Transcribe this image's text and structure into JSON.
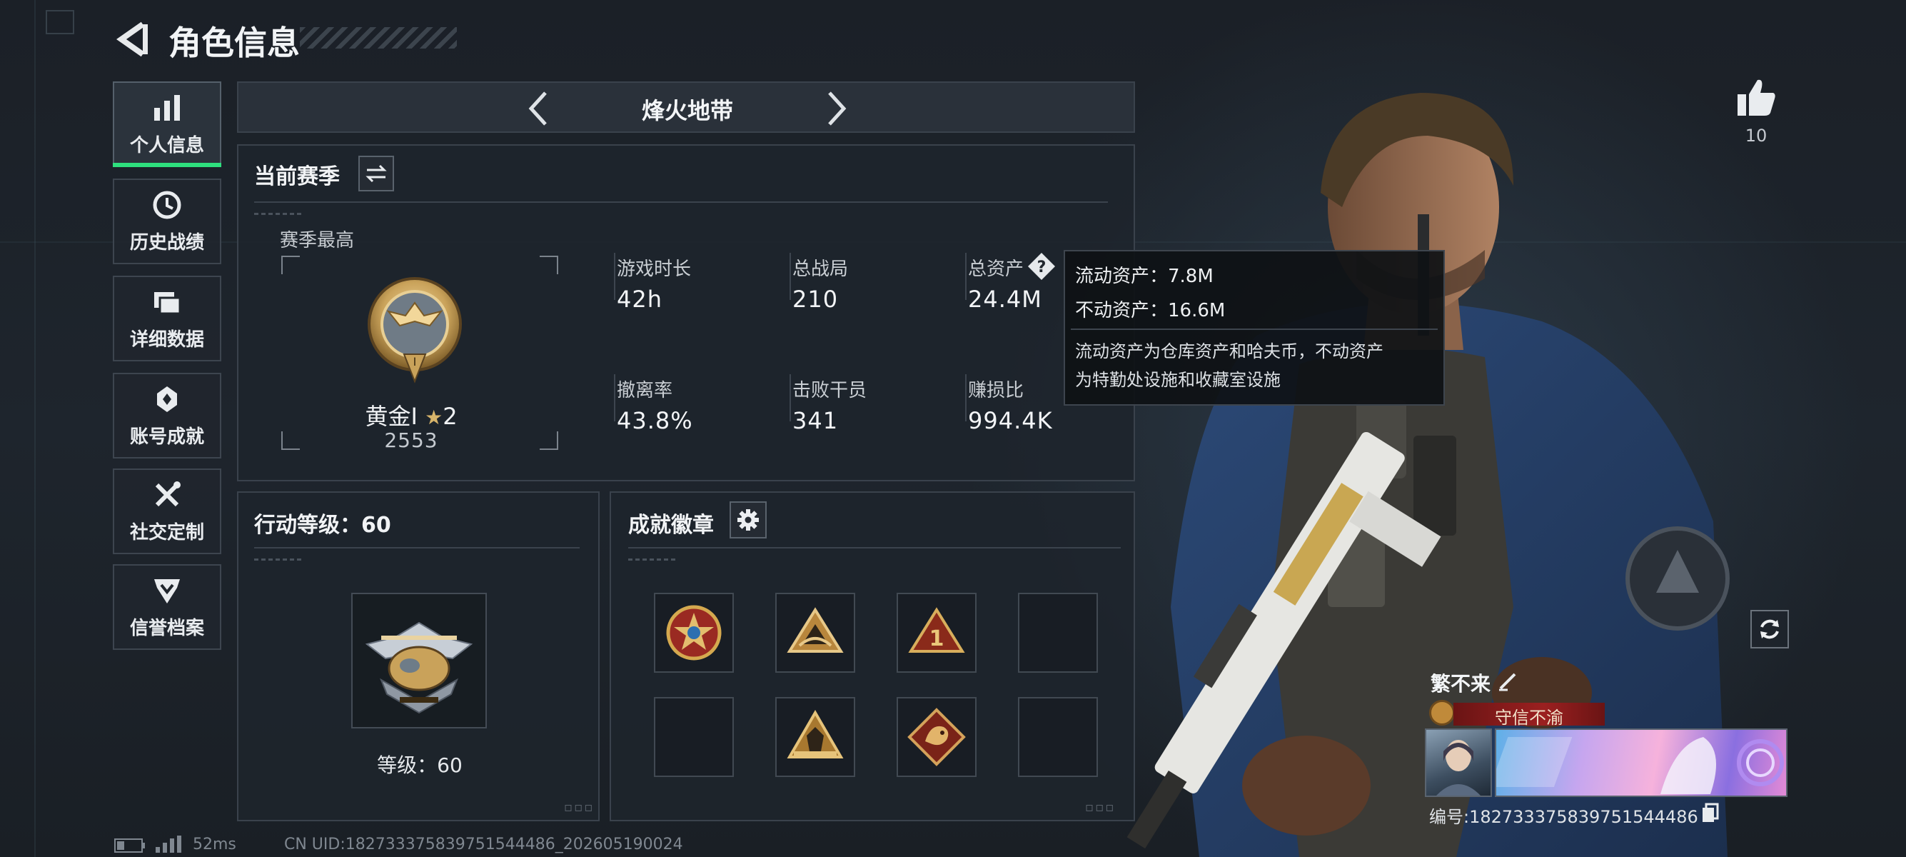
{
  "header": {
    "title": "角色信息",
    "back_icon": "back-arrow-icon"
  },
  "sidebar": {
    "items": [
      {
        "label": "个人信息",
        "icon": "bar-chart-icon",
        "active": true
      },
      {
        "label": "历史战绩",
        "icon": "clock-history-icon",
        "active": false
      },
      {
        "label": "详细数据",
        "icon": "folders-icon",
        "active": false
      },
      {
        "label": "账号成就",
        "icon": "achievement-icon",
        "active": false
      },
      {
        "label": "社交定制",
        "icon": "tools-icon",
        "active": false
      },
      {
        "label": "信誉档案",
        "icon": "credit-icon",
        "active": false
      }
    ]
  },
  "mode_selector": {
    "title": "烽火地带",
    "prev_icon": "chevron-left-icon",
    "next_icon": "chevron-right-icon"
  },
  "season": {
    "title": "当前赛季",
    "switch_icon": "swap-icon",
    "best_label": "赛季最高",
    "rank_name": "黄金Ⅰ",
    "rank_stars": "2",
    "rank_points": "2553",
    "stats": [
      {
        "label": "游戏时长",
        "value": "42h"
      },
      {
        "label": "总战局",
        "value": "210"
      },
      {
        "label": "总资产",
        "value": "24.4M",
        "help_icon": "question-icon"
      },
      {
        "label": "撤离率",
        "value": "43.8%"
      },
      {
        "label": "击败干员",
        "value": "341"
      },
      {
        "label": "赚损比",
        "value": "994.4K"
      }
    ]
  },
  "tooltip": {
    "line1": "流动资产：7.8M",
    "line2": "不动资产：16.6M",
    "desc1": "流动资产为仓库资产和哈夫币，不动资产",
    "desc2": "为特勤处设施和收藏室设施"
  },
  "action_level": {
    "title": "行动等级：60",
    "level_label": "等级：60"
  },
  "achievements": {
    "title": "成就徽章",
    "settings_icon": "gear-icon",
    "slots": [
      "star-emblem",
      "mountain-badge",
      "number-one-badge",
      "empty",
      "empty",
      "wolf-badge",
      "dragon-badge",
      "empty"
    ]
  },
  "likes": {
    "icon": "thumbs-up-icon",
    "count": "10"
  },
  "refresh_icon": "refresh-icon",
  "player_card": {
    "name": "繁不来",
    "edit_icon": "pencil-icon",
    "title_badge": "守信不渝",
    "id_text": "编号:182733375839751544486",
    "copy_icon": "copy-icon"
  },
  "status_bar": {
    "battery_icon": "battery-icon",
    "signal_icon": "signal-icon",
    "ping": "52ms",
    "uid": "CN UID:182733375839751544486_202605190024"
  },
  "colors": {
    "accent": "#2ee07e",
    "title_red": "#8b1a1a",
    "gold": "#c9a25a"
  }
}
